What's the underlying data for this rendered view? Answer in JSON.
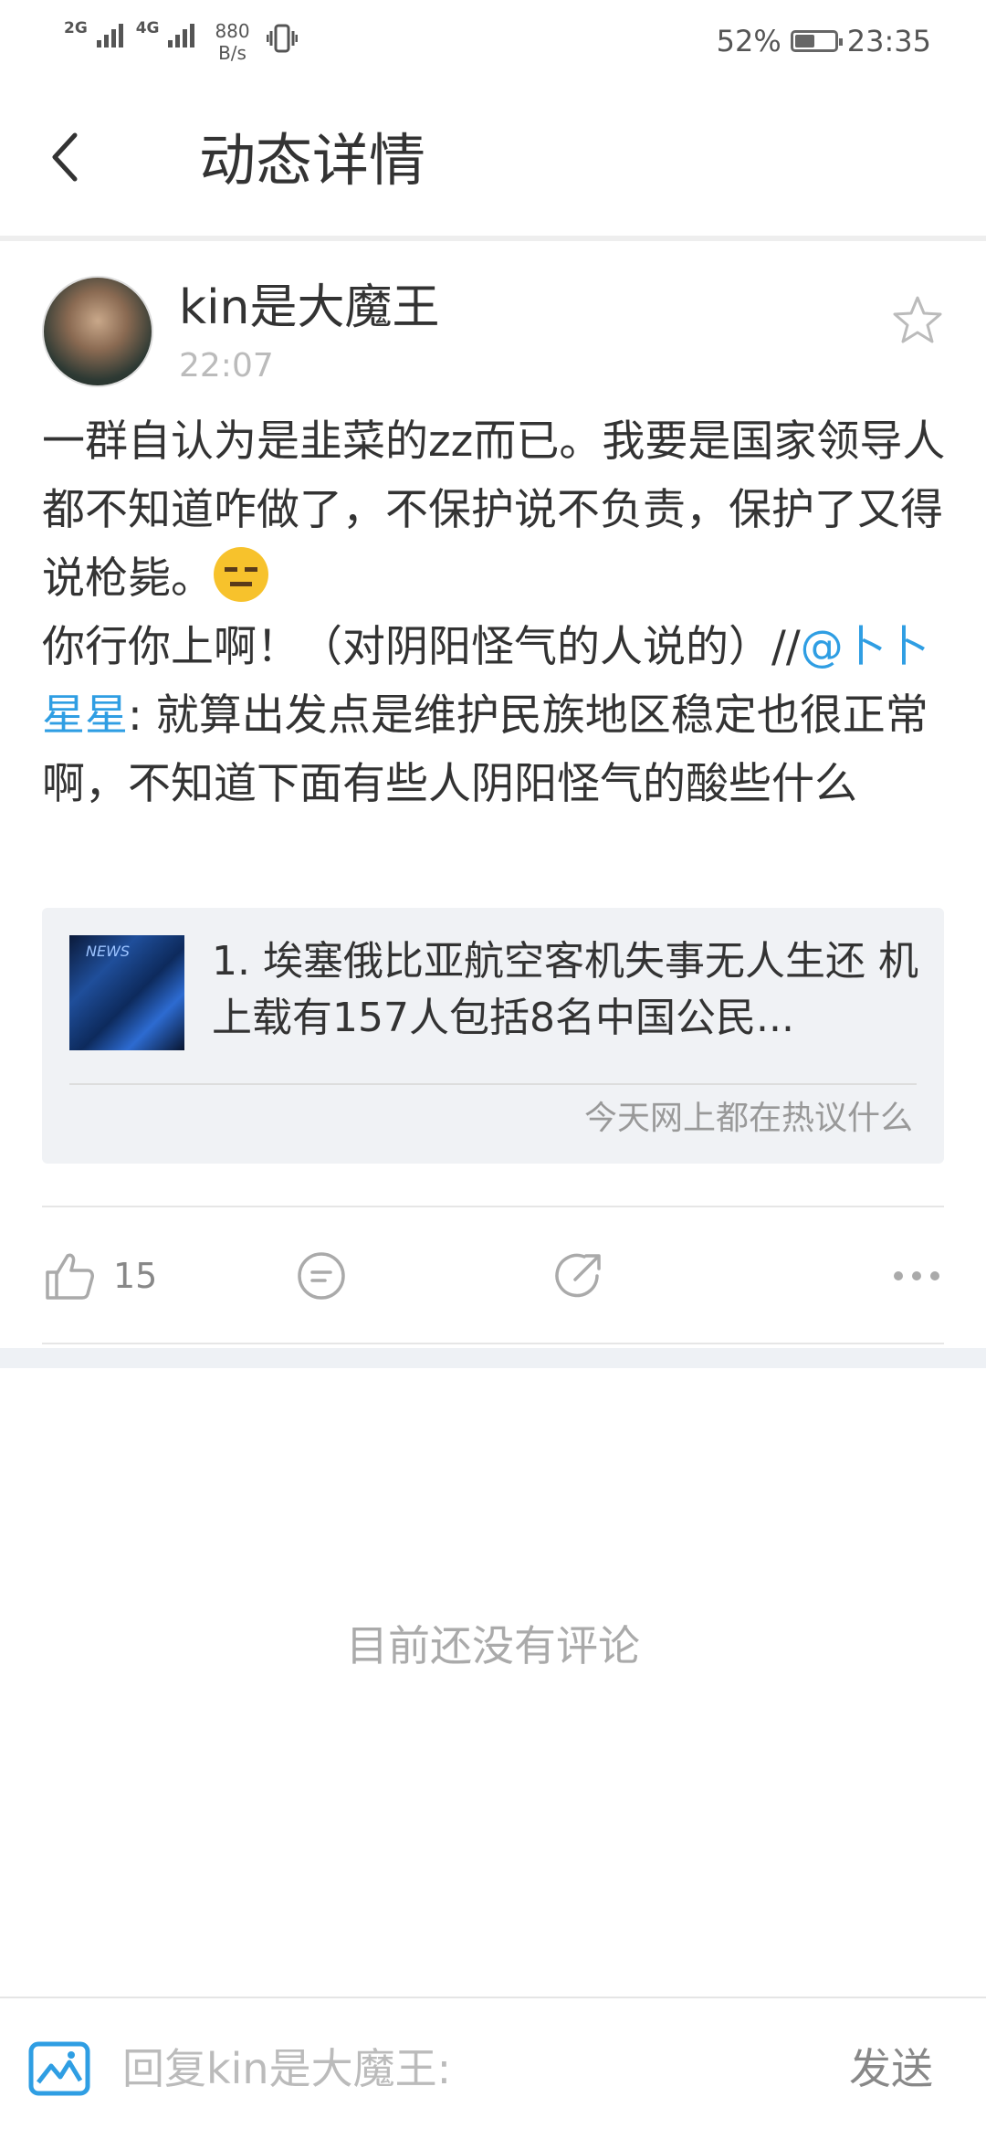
{
  "status_bar": {
    "signal1": "2G",
    "signal2": "4G",
    "speed_value": "880",
    "speed_unit": "B/s",
    "battery": "52%",
    "battery_level": 0.52,
    "time": "23:35"
  },
  "header": {
    "title": "动态详情"
  },
  "post": {
    "author": "kin是大魔王",
    "time": "22:07",
    "text_part1": "一群自认为是韭菜的zz而已。我要是国家领导人都不知道咋做了，不保护说不负责，保护了又得说枪毙。",
    "text_part2": "你行你上啊！（对阴阳怪气的人说的）//",
    "mention": "@卜卜星星",
    "text_part3": ": 就算出发点是维护民族地区稳定也很正常啊，不知道下面有些人阴阳怪气的酸些什么",
    "emoji": "expressionless-face"
  },
  "card": {
    "title": "1. 埃塞俄比亚航空客机失事无人生还 机上载有157人包括8名中国公民...",
    "footer": "今天网上都在热议什么",
    "thumb_text": "NEWS"
  },
  "actions": {
    "like_count": "15"
  },
  "comments": {
    "empty_text": "目前还没有评论"
  },
  "reply": {
    "placeholder": "回复kin是大魔王:",
    "send_label": "发送"
  },
  "colors": {
    "accent": "#2f9ee3",
    "muted": "#aaaaaa"
  }
}
